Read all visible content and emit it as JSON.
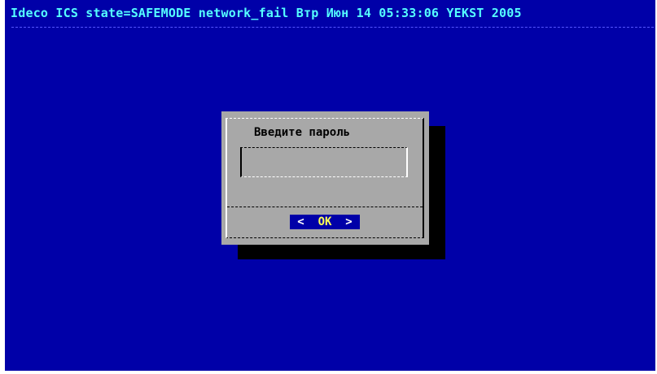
{
  "status_bar": {
    "text": "Ideco ICS state=SAFEMODE network_fail Втр Июн 14 05:33:06 YEKST 2005"
  },
  "dialog": {
    "title": "Введите пароль",
    "password_value": "",
    "ok_button": {
      "left_bracket": "<",
      "label": "OK",
      "right_bracket": ">"
    }
  },
  "colors": {
    "background": "#0000a8",
    "status_text": "#55ffff",
    "dialog": "#a8a8a8",
    "button_label": "#ffff55"
  }
}
